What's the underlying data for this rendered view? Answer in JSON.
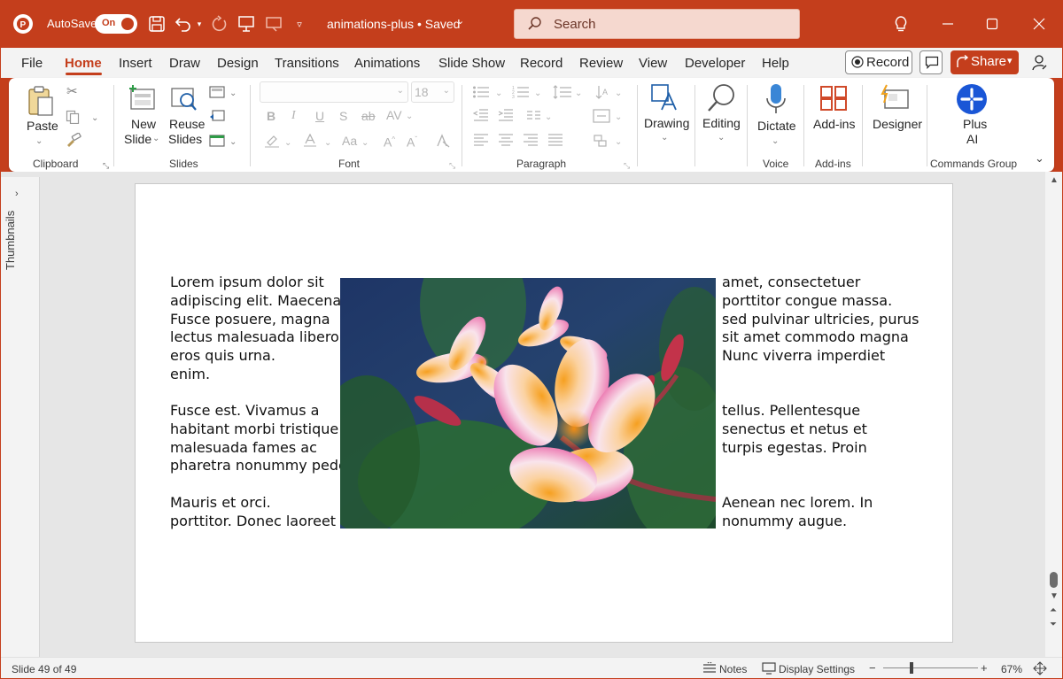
{
  "app": {
    "autosave_label": "AutoSave",
    "autosave_state": "On",
    "document_title": "animations-plus • Saved",
    "accent_color": "#c43e1c"
  },
  "search": {
    "placeholder": "Search"
  },
  "titlebar_icons": [
    "powerpoint-logo-icon",
    "save-icon",
    "undo-icon",
    "redo-icon",
    "present-from-beginning-icon",
    "present-icon",
    "customize-toolbar-icon",
    "lightbulb-icon",
    "minimize-icon",
    "maximize-icon",
    "close-icon"
  ],
  "menu": {
    "tabs": [
      "File",
      "Home",
      "Insert",
      "Draw",
      "Design",
      "Transitions",
      "Animations",
      "Slide Show",
      "Record",
      "Review",
      "View",
      "Developer",
      "Help"
    ],
    "active_tab": "Home",
    "record_label": "Record",
    "share_label": "Share"
  },
  "ribbon": {
    "clipboard": {
      "paste_label": "Paste",
      "group_label": "Clipboard"
    },
    "slides": {
      "new_slide": [
        "New",
        "Slide"
      ],
      "reuse_slides": [
        "Reuse",
        "Slides"
      ],
      "group_label": "Slides"
    },
    "font": {
      "font_size": "18",
      "group_label": "Font",
      "buttons": [
        "B",
        "I",
        "U",
        "S",
        "ab",
        "AV"
      ]
    },
    "paragraph": {
      "group_label": "Paragraph"
    },
    "drawing": {
      "label": "Drawing"
    },
    "editing": {
      "label": "Editing"
    },
    "voice": {
      "dictate_label": "Dictate",
      "group_label": "Voice"
    },
    "addins": {
      "label": "Add-ins",
      "group_label": "Add-ins"
    },
    "designer": {
      "label": "Designer"
    },
    "plus_ai": {
      "label": [
        "Plus",
        "AI"
      ],
      "group_label": "Commands Group"
    }
  },
  "sidebar": {
    "thumbnails_label": "Thumbnails"
  },
  "slide": {
    "left_paragraphs": [
      "Lorem ipsum dolor sit\nadipiscing elit. Maecenas\nFusce posuere, magna\nlectus malesuada libero,\neros quis urna.\nenim.",
      "Fusce est. Vivamus a\nhabitant morbi tristique\nmalesuada fames ac\npharetra nonummy pede.",
      "Mauris et orci.\nporttitor. Donec laoreet"
    ],
    "right_paragraphs": [
      "amet, consectetuer\nporttitor congue massa.\nsed pulvinar ultricies, purus\nsit amet commodo magna\nNunc viverra imperdiet",
      "tellus. Pellentesque\nsenectus et netus et\nturpis egestas. Proin",
      "Aenean nec lorem. In\nnonummy augue."
    ]
  },
  "status": {
    "slide_info": "Slide 49 of 49",
    "notes_label": "Notes",
    "display_settings_label": "Display Settings",
    "zoom_level": "67%",
    "zoom_fraction": 0.3
  }
}
